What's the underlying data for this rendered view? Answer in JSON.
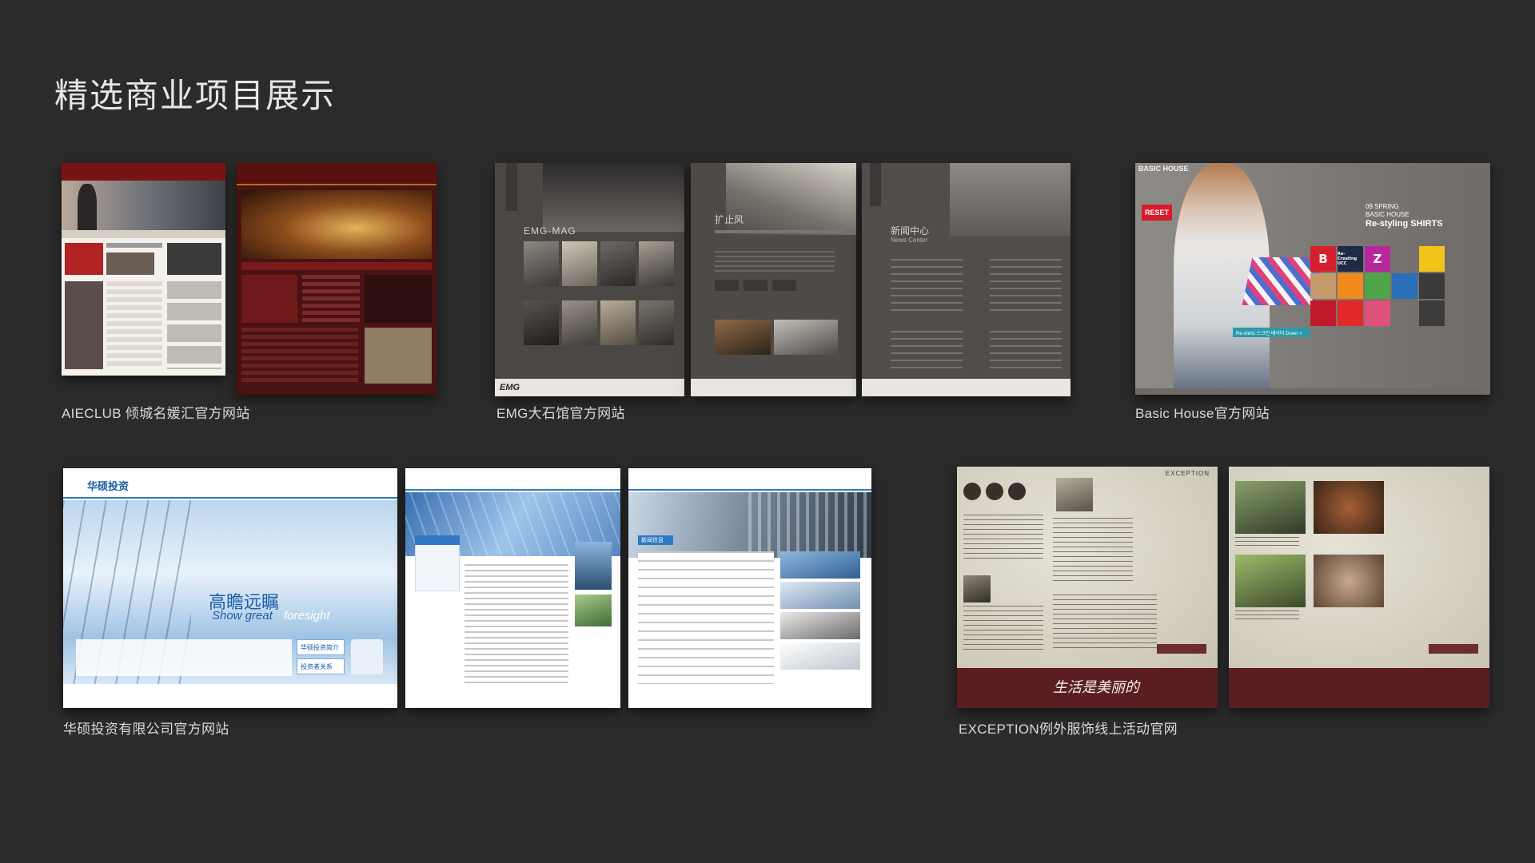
{
  "page": {
    "title": "精选商业项目展示"
  },
  "projects": [
    {
      "caption": "AIECLUB 倾城名媛汇官方网站"
    },
    {
      "caption": "EMG大石馆官方网站"
    },
    {
      "caption": "Basic House官方网站"
    },
    {
      "caption": "华硕投资有限公司官方网站"
    },
    {
      "caption": "EXCEPTION例外服饰线上活动官网"
    }
  ],
  "thumbs": {
    "emg_mag": "EMG-MAG",
    "emg_custom": "扩止风",
    "emg_news": "新闻中心",
    "emg_news_en": "News Center",
    "emg_logo": "EMG",
    "bh_logo": "BASIC HOUSE",
    "bh_headline_1": "09 SPRING",
    "bh_headline_2": "BASIC HOUSE",
    "bh_headline_3": "Re-styling SHIRTS",
    "bh_reset": "RESET",
    "bh_tile_b": "B",
    "bh_tile_z": "Z",
    "bh_tile_ucc": "Re-Creating UCC",
    "bh_cta": "Re-shirts 스크린 베이비 Down >",
    "hs_logo": "华硕投资",
    "hs_slogan_cn": "高瞻远瞩",
    "hs_slogan_en_1": "Show great",
    "hs_slogan_en_2": "foresight",
    "hs_btn_1": "华硕投资简介",
    "hs_btn_2": "投资者关系",
    "hs_news": "新闻信息",
    "ex_brand": "EXCEPTION",
    "ex_script": "生活是美丽的"
  },
  "colors": {
    "background": "#2b2b2b",
    "title": "#e6e6e6",
    "caption": "#d9d9d9"
  }
}
